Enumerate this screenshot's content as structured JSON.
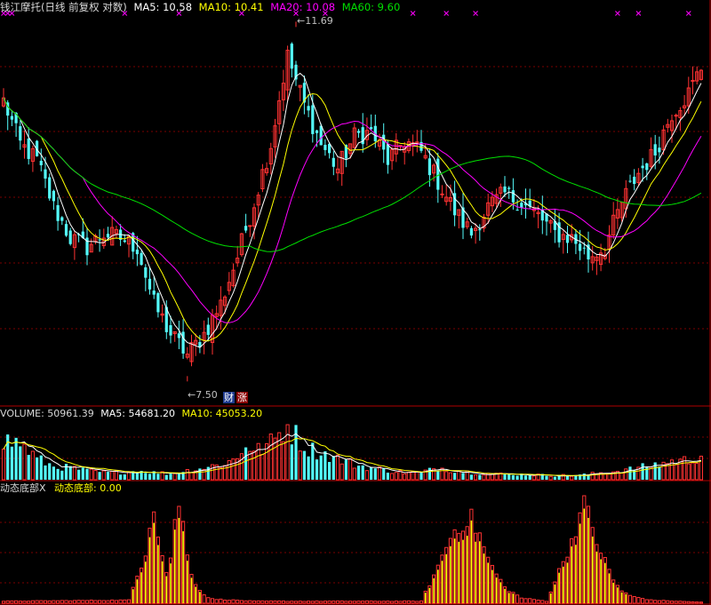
{
  "colors": {
    "background": "#000000",
    "up": "#ff3232",
    "down": "#54fcfc",
    "ma5": "#ffffff",
    "ma10": "#ffff00",
    "ma20": "#ff00ff",
    "ma60": "#00e000",
    "grid": "#7a0000",
    "divider": "#b00000",
    "text": "#c0c0c0",
    "bottom_red": "#ff3232",
    "bottom_yellow": "#ffff00"
  },
  "header": {
    "title": "钱江摩托(日线 前复权 对数)",
    "ma5_label": "MA5: 10.58",
    "ma10_label": "MA10: 10.41",
    "ma20_label": "MA20: 10.08",
    "ma60_label": "MA60: 9.60"
  },
  "annotations": {
    "high": "11.69",
    "low": "7.50",
    "badge_cai": "财",
    "badge_zhang": "涨"
  },
  "volume_header": {
    "volume_label": "VOLUME: 50961.39",
    "ma5_label": "MA5: 54681.20",
    "ma10_label": "MA10: 45053.20"
  },
  "indicator_header": {
    "name_label": "动态底部X",
    "value_label": "动态底部: 0.00"
  },
  "chart_data": {
    "type": "candlestick",
    "price_scale": "log",
    "price_range": [
      7.3,
      11.85
    ],
    "high": 11.69,
    "low": 7.5,
    "key_closes": [
      [
        0,
        10.6
      ],
      [
        4,
        10.05
      ],
      [
        8,
        9.85
      ],
      [
        12,
        9.3
      ],
      [
        16,
        8.95
      ],
      [
        20,
        8.85
      ],
      [
        24,
        9.0
      ],
      [
        28,
        8.95
      ],
      [
        32,
        8.85
      ],
      [
        36,
        8.25
      ],
      [
        40,
        7.95
      ],
      [
        44,
        7.75
      ],
      [
        48,
        7.95
      ],
      [
        52,
        8.25
      ],
      [
        56,
        8.75
      ],
      [
        60,
        9.35
      ],
      [
        64,
        10.05
      ],
      [
        68,
        11.2
      ],
      [
        72,
        10.55
      ],
      [
        76,
        10.05
      ],
      [
        80,
        9.75
      ],
      [
        84,
        10.15
      ],
      [
        88,
        10.2
      ],
      [
        92,
        9.85
      ],
      [
        96,
        10.1
      ],
      [
        100,
        9.95
      ],
      [
        104,
        9.6
      ],
      [
        108,
        9.25
      ],
      [
        112,
        9.0
      ],
      [
        116,
        9.3
      ],
      [
        120,
        9.45
      ],
      [
        124,
        9.35
      ],
      [
        128,
        9.2
      ],
      [
        132,
        9.0
      ],
      [
        136,
        8.95
      ],
      [
        140,
        8.75
      ],
      [
        144,
        8.85
      ],
      [
        148,
        9.35
      ],
      [
        152,
        9.7
      ],
      [
        156,
        9.95
      ],
      [
        160,
        10.45
      ],
      [
        164,
        10.7
      ],
      [
        167,
        11.05
      ]
    ],
    "key_volumes": [
      [
        0,
        0.65
      ],
      [
        4,
        0.6
      ],
      [
        8,
        0.35
      ],
      [
        12,
        0.22
      ],
      [
        16,
        0.2
      ],
      [
        20,
        0.15
      ],
      [
        24,
        0.12
      ],
      [
        28,
        0.12
      ],
      [
        32,
        0.15
      ],
      [
        36,
        0.12
      ],
      [
        40,
        0.1
      ],
      [
        44,
        0.15
      ],
      [
        48,
        0.2
      ],
      [
        52,
        0.25
      ],
      [
        56,
        0.35
      ],
      [
        58,
        0.62
      ],
      [
        60,
        0.45
      ],
      [
        64,
        0.6
      ],
      [
        68,
        0.9
      ],
      [
        72,
        0.55
      ],
      [
        76,
        0.45
      ],
      [
        80,
        0.35
      ],
      [
        84,
        0.25
      ],
      [
        88,
        0.2
      ],
      [
        92,
        0.15
      ],
      [
        96,
        0.12
      ],
      [
        100,
        0.12
      ],
      [
        104,
        0.2
      ],
      [
        108,
        0.15
      ],
      [
        112,
        0.12
      ],
      [
        116,
        0.1
      ],
      [
        120,
        0.09
      ],
      [
        124,
        0.09
      ],
      [
        128,
        0.08
      ],
      [
        132,
        0.07
      ],
      [
        136,
        0.07
      ],
      [
        140,
        0.09
      ],
      [
        144,
        0.12
      ],
      [
        148,
        0.15
      ],
      [
        152,
        0.2
      ],
      [
        156,
        0.25
      ],
      [
        160,
        0.3
      ],
      [
        164,
        0.32
      ],
      [
        167,
        0.4
      ]
    ],
    "indicator_key_values": [
      [
        0,
        0.02
      ],
      [
        30,
        0.03
      ],
      [
        34,
        0.5
      ],
      [
        35,
        0.78
      ],
      [
        36,
        0.95
      ],
      [
        37,
        0.7
      ],
      [
        38,
        0.45
      ],
      [
        39,
        0.3
      ],
      [
        40,
        0.45
      ],
      [
        41,
        0.75
      ],
      [
        42,
        0.98
      ],
      [
        43,
        0.75
      ],
      [
        44,
        0.45
      ],
      [
        45,
        0.3
      ],
      [
        46,
        0.2
      ],
      [
        47,
        0.13
      ],
      [
        48,
        0.08
      ],
      [
        50,
        0.04
      ],
      [
        60,
        0.02
      ],
      [
        100,
        0.02
      ],
      [
        104,
        0.35
      ],
      [
        106,
        0.55
      ],
      [
        108,
        0.7
      ],
      [
        110,
        0.78
      ],
      [
        112,
        0.8
      ],
      [
        114,
        0.65
      ],
      [
        116,
        0.42
      ],
      [
        118,
        0.28
      ],
      [
        120,
        0.15
      ],
      [
        124,
        0.05
      ],
      [
        130,
        0.02
      ],
      [
        134,
        0.4
      ],
      [
        136,
        0.6
      ],
      [
        138,
        0.85
      ],
      [
        139,
        1.0
      ],
      [
        140,
        0.85
      ],
      [
        142,
        0.6
      ],
      [
        144,
        0.4
      ],
      [
        146,
        0.22
      ],
      [
        148,
        0.12
      ],
      [
        150,
        0.07
      ],
      [
        155,
        0.03
      ],
      [
        167,
        0.01
      ]
    ],
    "sell_markers": [
      0,
      1,
      2,
      29,
      42,
      57,
      70,
      77,
      98,
      106,
      113,
      147,
      152,
      164
    ]
  }
}
